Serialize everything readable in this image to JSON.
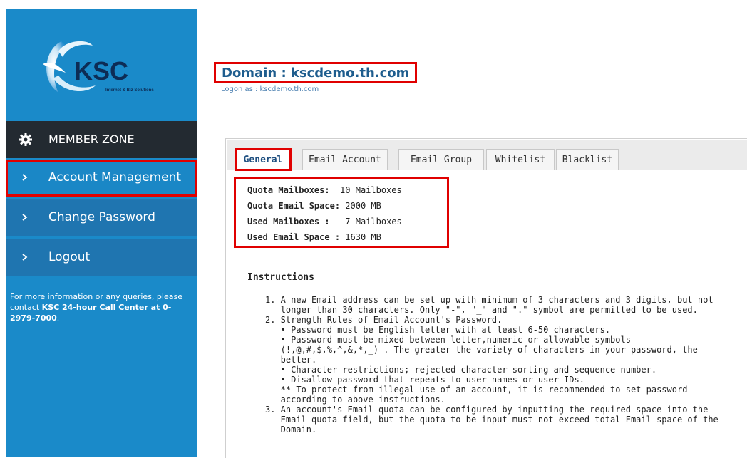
{
  "brand": {
    "logo_text": "KSC",
    "logo_tagline": "Internet & Biz Solutions",
    "colors": {
      "sidebar": "#1a8ac9",
      "menu_header": "#232a31",
      "nav": "#1f75b0",
      "highlight": "#e00000",
      "title": "#1e5d8e"
    }
  },
  "sidebar": {
    "header": {
      "label": "MEMBER ZONE",
      "icon": "gear-icon"
    },
    "items": [
      {
        "label": "Account Management",
        "icon": "chevron-right-icon",
        "active": true
      },
      {
        "label": "Change Password",
        "icon": "chevron-right-icon",
        "active": false
      },
      {
        "label": "Logout",
        "icon": "chevron-right-icon",
        "active": false
      }
    ],
    "info": {
      "text": "For more information or any queries, please contact ",
      "strong": "KSC 24-hour Call Center at 0-2979-7000",
      "end": "."
    }
  },
  "header": {
    "domain_title": "Domain : kscdemo.th.com",
    "logon": "Logon as : kscdemo.th.com"
  },
  "tabs": [
    {
      "label": "General",
      "active": true
    },
    {
      "label": "Email Account",
      "active": false
    },
    {
      "label": "Email Group",
      "active": false
    },
    {
      "label": "Whitelist",
      "active": false
    },
    {
      "label": "Blacklist",
      "active": false
    }
  ],
  "quota": [
    {
      "label": "Quota Mailboxes:",
      "value": "10 Mailboxes"
    },
    {
      "label": "Quota Email Space:",
      "value": "2000 MB"
    },
    {
      "label": "Used Mailboxes :",
      "value": "7 Mailboxes"
    },
    {
      "label": "Used Email Space :",
      "value": "1630 MB"
    }
  ],
  "instructions": {
    "title": "Instructions",
    "body": "1. A new Email address can be set up with minimum of 3 characters and 3 digits, but not\n   longer than 30 characters. Only \"-\", \"_\" and \".\" symbol are permitted to be used.\n2. Strength Rules of Email Account's Password.\n   • Password must be English letter with at least 6-50 characters.\n   • Password must be mixed between letter,numeric or allowable symbols\n   (!,@,#,$,%,^,&,*,_) . The greater the variety of characters in your password, the\n   better.\n   • Character restrictions; rejected character sorting and sequence number.\n   • Disallow password that repeats to user names or user IDs.\n   ** To protect from illegal use of an account, it is recommended to set password\n   according to above instructions.\n3. An account's Email quota can be configured by inputting the required space into the\n   Email quota field, but the quota to be input must not exceed total Email space of the\n   Domain."
  }
}
